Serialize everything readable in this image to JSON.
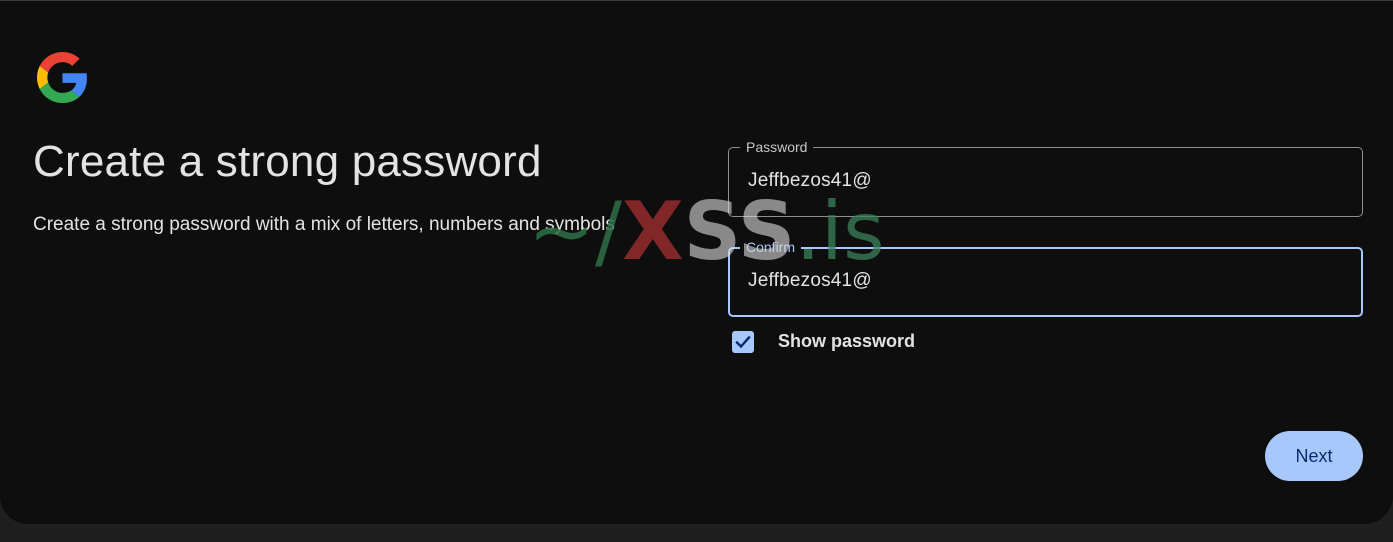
{
  "page": {
    "title": "Create a strong password",
    "subtitle": "Create a strong password with a mix of letters, numbers and symbols"
  },
  "password_field": {
    "label": "Password",
    "value": "Jeffbezos41@"
  },
  "confirm_field": {
    "label": "Confirm",
    "value": "Jeffbezos41@"
  },
  "show_password": {
    "label": "Show password",
    "checked": true
  },
  "next_button": {
    "label": "Next"
  },
  "watermark": {
    "tilde": "~/",
    "x": "X",
    "ss": "SS",
    "domain": ".is"
  },
  "icons": {
    "logo": "google-g-logo",
    "checkbox": "check-icon"
  },
  "colors": {
    "card_bg": "#0e0e0e",
    "page_bg": "#1f1f1f",
    "accent": "#a8c7fa",
    "button_text": "#062e6f",
    "text": "#e3e3e3"
  }
}
